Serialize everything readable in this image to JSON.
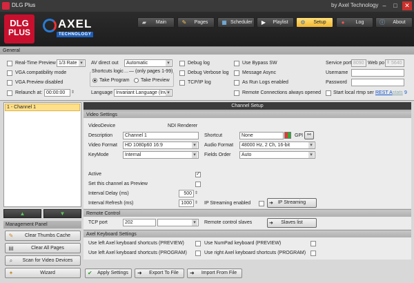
{
  "window": {
    "title": "DLG Plus",
    "company": "by Axel Technology"
  },
  "logos": {
    "dlg_line1": "DLG",
    "dlg_line2": "PLUS",
    "axel_name": "AXEL",
    "axel_sub": "TECHNOLOGY"
  },
  "nav": {
    "main": "Main",
    "pages": "Pages",
    "scheduler": "Scheduler",
    "playlist": "Playlist",
    "setup": "Setup",
    "log": "Log",
    "about": "About"
  },
  "general": {
    "header": "General",
    "realtime_preview_label": "Real-Time Preview",
    "realtime_preview_value": "1/3 Rate",
    "vga_compat_label": "VGA compatibility mode",
    "vga_preview_disabled_label": "VGA Preview disabled",
    "relaunch_label": "Relaunch at:",
    "relaunch_value": "00:00:00",
    "av_direct_out_label": "AV direct out",
    "av_direct_out_value": "Automatic",
    "shortcuts_logic_label": "Shortcuts logic",
    "shortcuts_logic_note": "(only pages 1-99)",
    "take_program_label": "Take Program",
    "take_preview_label": "Take Preview",
    "language_label": "Language",
    "language_value": "Invariant Language (Inv",
    "debug_log_label": "Debug log",
    "debug_verbose_label": "Debug Verbose log",
    "tcpip_log_label": "TCP/IP log",
    "bypass_sw_label": "Use Bypass SW",
    "message_async_label": "Message Async",
    "as_run_logs_label": "As Run Logs enabled",
    "remote_conn_label": "Remote Connections always opened",
    "service_port_label": "Service port",
    "service_port_value": "8090",
    "web_port_label": "Web po",
    "web_port_value": "5640",
    "username_label": "Username",
    "password_label": "Password",
    "rtmp_label": "Start local rtmp ser",
    "rest_link": "REST A",
    "stats_link": "stats"
  },
  "channels": {
    "items": [
      "1 - Channel 1"
    ]
  },
  "arrows": {
    "up": "▲",
    "down": "▼"
  },
  "management": {
    "header": "Management Panel",
    "clear_thumbs": "Clear Thumbs Cache",
    "clear_pages": "Clear All Pages",
    "scan_devices": "Scan for Video Devices",
    "wizard": "Wizard"
  },
  "channel_setup": {
    "header": "Channel Setup",
    "video_settings_header": "Video Settings",
    "video_device_label": "VideoDevice",
    "video_device_value": "NDI Renderer",
    "description_label": "Description",
    "description_value": "Channel 1",
    "shortcut_label": "Shortcut",
    "shortcut_value": "None",
    "gpi_label": "GPI",
    "video_format_label": "Video Format",
    "video_format_value": "HD 1080p60 16:9",
    "audio_format_label": "Audio Format",
    "audio_format_value": "48000 Hz, 2 Ch, 16-bit",
    "keymode_label": "KeyMode",
    "keymode_value": "Internal",
    "fields_order_label": "Fields Order",
    "fields_order_value": "Auto",
    "active_label": "Active",
    "set_preview_label": "Set this channel as Preview",
    "interval_delay_label": "Interval Delay (ms)",
    "interval_delay_value": "500",
    "interval_refresh_label": "Interval Refresh (ms)",
    "interval_refresh_value": "1000",
    "ip_streaming_enabled_label": "IP Streaming enabled",
    "ip_streaming_button": "IP Streaming",
    "remote_control_header": "Remote Control",
    "tcp_port_label": "TCP port",
    "tcp_port_value": "202",
    "remote_slaves_label": "Remote control slaves",
    "slaves_list_button": "Slaves list",
    "axel_keyboard_header": "Axel Keyboard Settings",
    "left_kbd_preview_label": "Use left Axel keyboard shortcuts (PREVIEW)",
    "numpad_preview_label": "Use NumPad keyboard (PREVIEW)",
    "left_kbd_program_label": "Use left Axel keyboard shortcuts (PROGRAM)",
    "right_kbd_program_label": "Use right Axel keyboard shortcuts (PROGRAM)"
  },
  "bottom": {
    "apply": "Apply Settings",
    "export": "Export To File",
    "import": "Import From File"
  },
  "colors": {
    "accent": "#f2b632",
    "brand_red": "#c8102e",
    "axel_blue": "#1f5fb8"
  }
}
